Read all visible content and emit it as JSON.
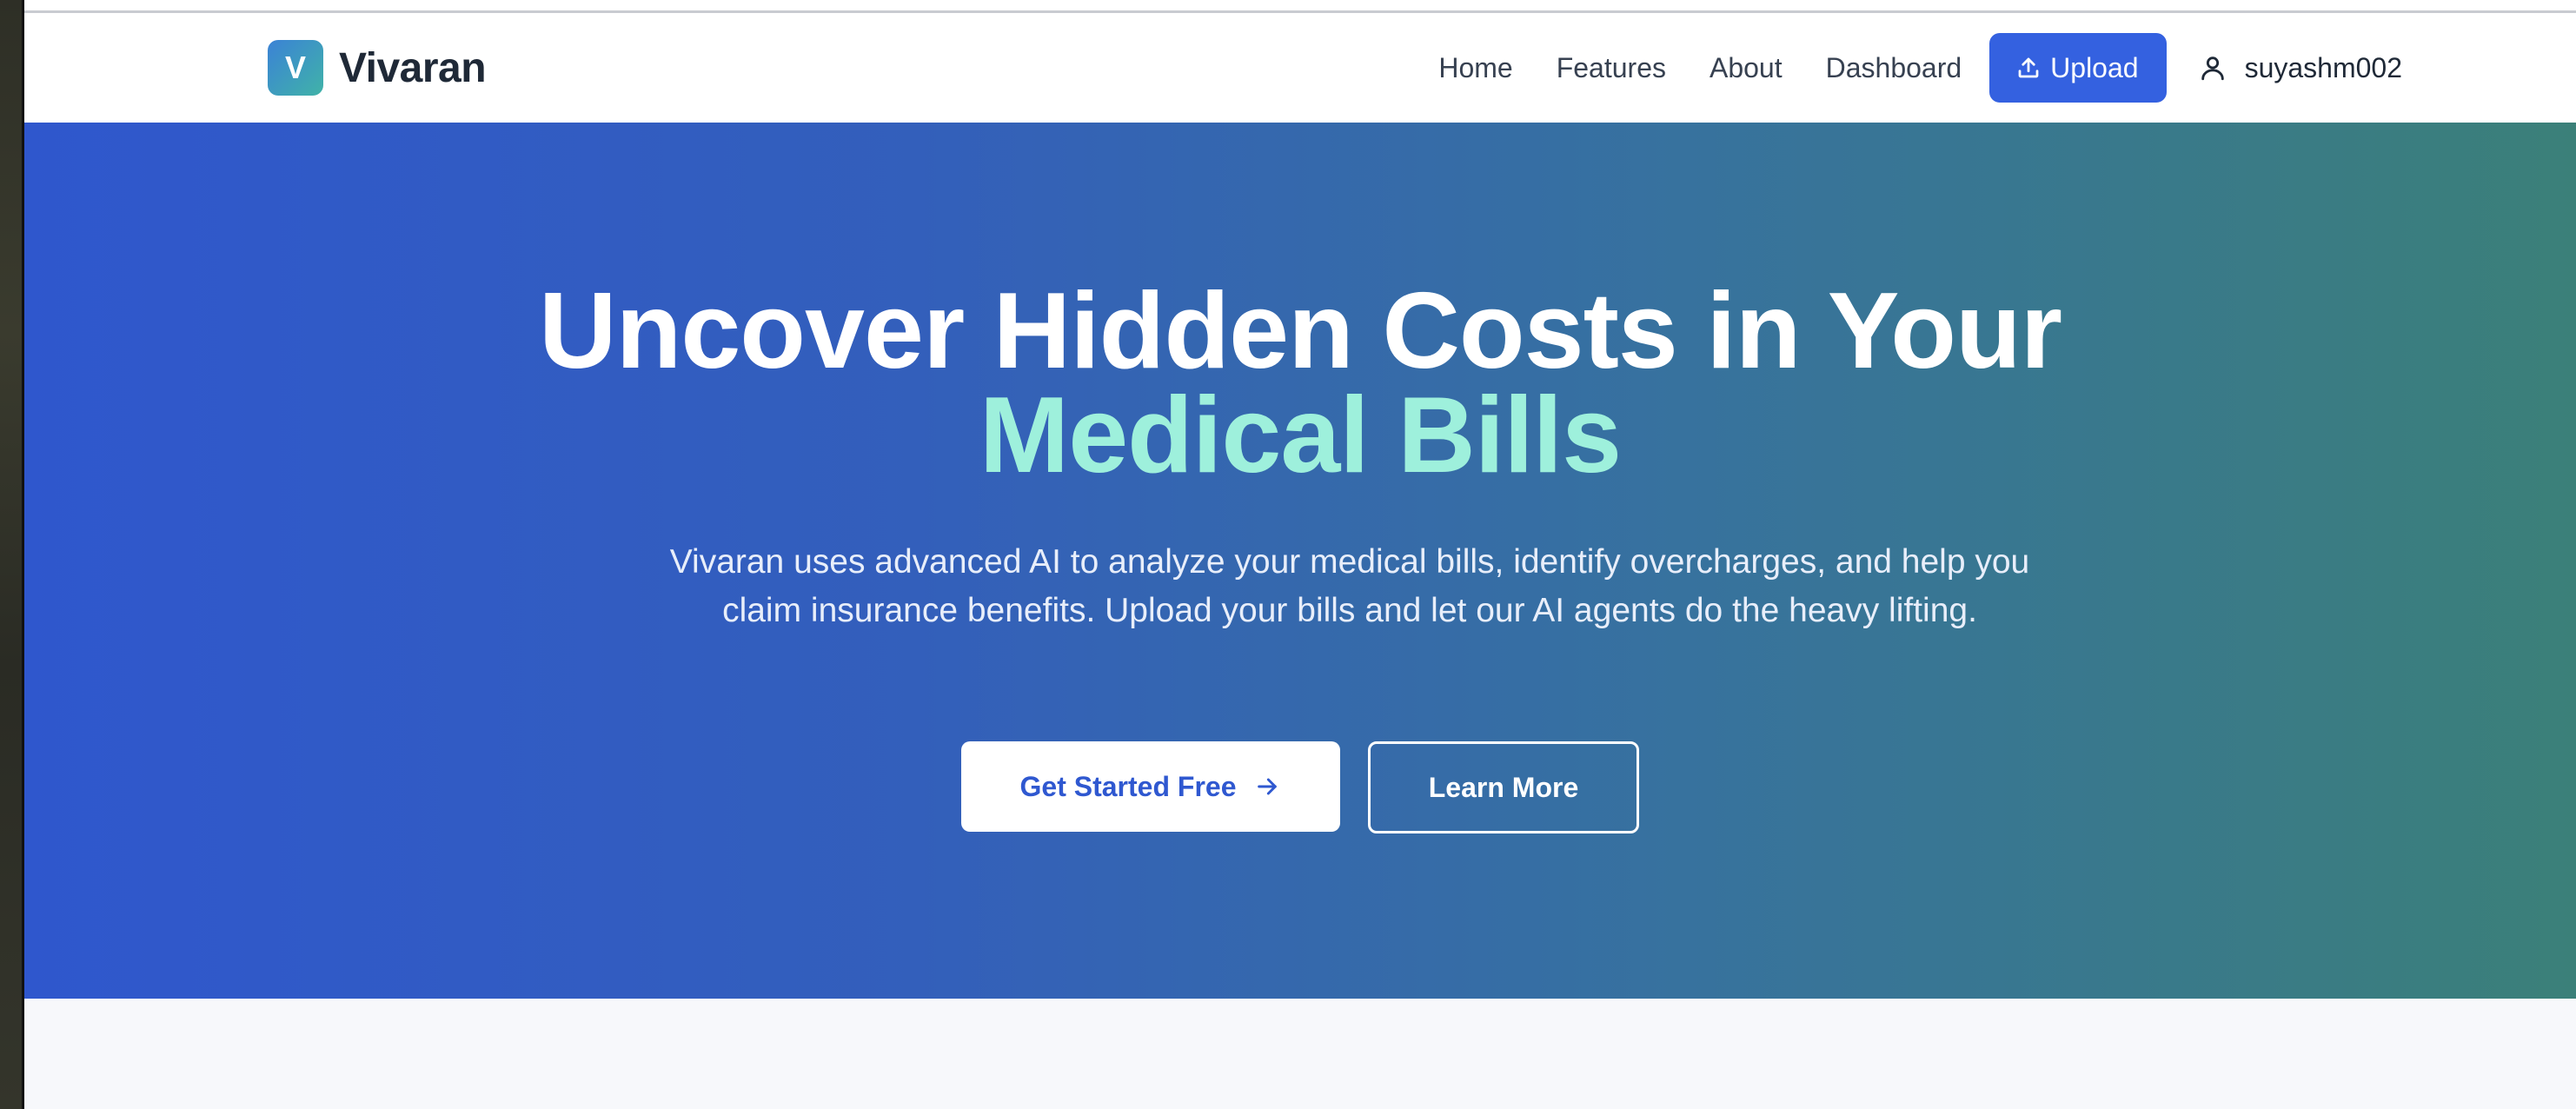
{
  "brand": {
    "logo_letter": "V",
    "name": "Vivaran"
  },
  "nav": {
    "links": [
      "Home",
      "Features",
      "About",
      "Dashboard"
    ],
    "upload_label": "Upload",
    "username": "suyashm002"
  },
  "hero": {
    "title_line1": "Uncover Hidden Costs in Your",
    "title_line2": "Medical Bills",
    "subtitle": "Vivaran uses advanced AI to analyze your medical bills, identify overcharges, and help you claim insurance benefits. Upload your bills and let our AI agents do the heavy lifting.",
    "primary_cta": "Get Started Free",
    "secondary_cta": "Learn More"
  },
  "colors": {
    "primary": "#3461e0",
    "accent_text": "#9ef0dc",
    "gradient_start": "#2f57cd",
    "gradient_end": "#3b8079"
  },
  "icons": {
    "upload": "upload-icon",
    "user": "user-icon",
    "arrow": "arrow-right-icon"
  }
}
